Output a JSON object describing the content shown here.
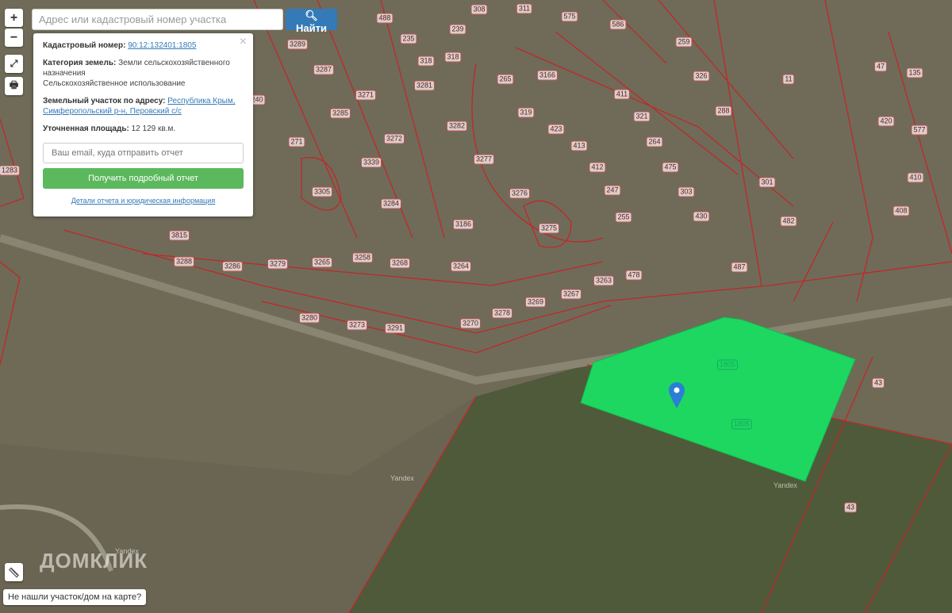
{
  "search": {
    "placeholder": "Адрес или кадастровый номер участка",
    "button": "Найти"
  },
  "controls": {
    "zoom_in": "+",
    "zoom_out": "−"
  },
  "panel": {
    "cad_label": "Кадастровый номер:",
    "cad_value": "90:12:132401:1805",
    "cat_label": "Категория земель:",
    "cat_value": "Земли сельскохозяйственного назначения",
    "use_value": "Сельскохозяйственное использование",
    "addr_label": "Земельный участок по адресу:",
    "addr_value": "Республика Крым, Симферопольский р-н, Перовский с/с",
    "area_label": "Уточненная площадь:",
    "area_value": "12 129 кв.м.",
    "email_placeholder": "Ваш email, куда отправить отчет",
    "get_report": "Получить подробный отчет",
    "details": "Детали отчета и юридическая информация",
    "close": "×"
  },
  "parcels": [
    "488",
    "235",
    "239",
    "308",
    "311",
    "575",
    "586",
    "3289",
    "318",
    "318",
    "259",
    "47",
    "135",
    "3287",
    "265",
    "3166",
    "326",
    "11",
    "3281",
    "3271",
    "411",
    "240",
    "319",
    "321",
    "288",
    "420",
    "577",
    "3285",
    "3282",
    "423",
    "264",
    "271",
    "3272",
    "413",
    "1283",
    "3339",
    "3277",
    "412",
    "475",
    "410",
    "301",
    "3305",
    "3284",
    "3276",
    "247",
    "303",
    "408",
    "255",
    "430",
    "482",
    "3186",
    "3275",
    "3815",
    "3288",
    "3286",
    "3279",
    "3265",
    "3258",
    "3268",
    "3264",
    "487",
    "3263",
    "478",
    "3269",
    "3267",
    "3278",
    "3280",
    "3273",
    "3291",
    "3270",
    "1805",
    "1805",
    "43",
    "43"
  ],
  "watermark": {
    "brand": "ДОМКЛИК",
    "yandex": "Yandex"
  },
  "not_found": "Не нашли участок/дом на карте?",
  "colors": {
    "selected": "#1ed760",
    "boundary": "#c0282a",
    "button": "#337ab7",
    "green": "#5cb85c"
  }
}
